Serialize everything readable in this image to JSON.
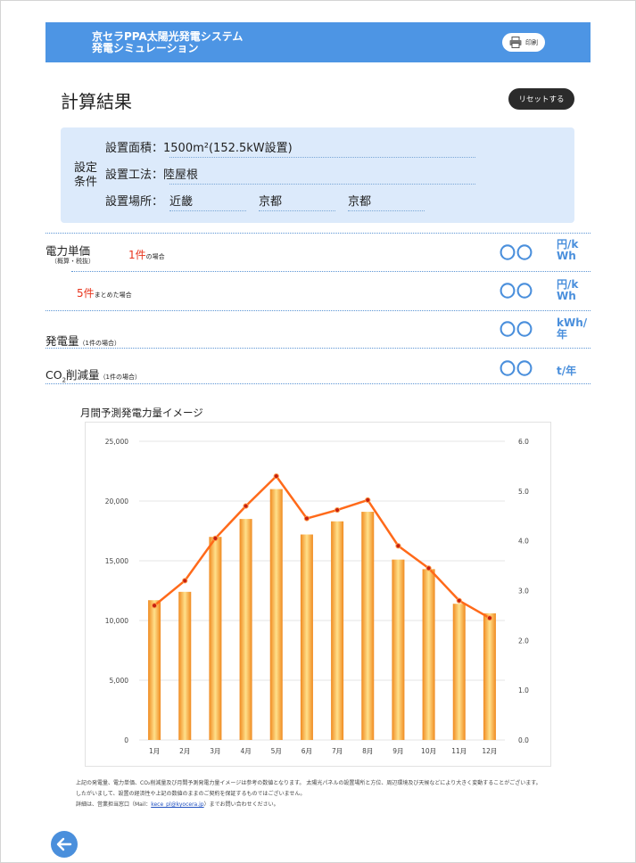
{
  "header": {
    "title_line1": "京セラPPA太陽光発電システム",
    "title_line2": "発電シミュレーション",
    "print_label": "印刷"
  },
  "page_title": "計算結果",
  "reset_label": "リセットする",
  "conditions": {
    "title": "設定条件",
    "area_label": "設置面積：",
    "area_value": "1500m²(152.5kW設置)",
    "method_label": "設置工法：",
    "method_value": "陸屋根",
    "place_label": "設置場所：",
    "region": "近畿",
    "prefecture": "京都",
    "city": "京都"
  },
  "results": {
    "unit_price_label": "電力単価",
    "unit_price_note": "（概算・税抜）",
    "case1_count": "1件",
    "case1_suffix": "の場合",
    "case1_value": "〇〇",
    "case1_unit_l1": "円/k",
    "case1_unit_l2": "Wh",
    "case5_count": "5件",
    "case5_suffix": "まとめた場合",
    "case5_value": "〇〇",
    "case5_unit_l1": "円/k",
    "case5_unit_l2": "Wh",
    "gen_label": "発電量",
    "gen_note": "（1件の場合）",
    "gen_value": "〇〇",
    "gen_unit_l1": "kWh/",
    "gen_unit_l2": "年",
    "co2_label_a": "CO",
    "co2_label_sub": "2",
    "co2_label_b": "削減量",
    "co2_note": "（1件の場合）",
    "co2_value": "〇〇",
    "co2_unit": "t/年"
  },
  "chart_title": "月間予測発電力量イメージ",
  "chart_data": {
    "type": "bar",
    "title": "月間予測発電力量イメージ",
    "categories": [
      "1月",
      "2月",
      "3月",
      "4月",
      "5月",
      "6月",
      "7月",
      "8月",
      "9月",
      "10月",
      "11月",
      "12月"
    ],
    "series": [
      {
        "values": [
          11700,
          12400,
          17000,
          18500,
          21000,
          17200,
          18300,
          19100,
          15100,
          14300,
          11400,
          10600
        ]
      },
      {
        "type": "line",
        "axis": "right",
        "values": [
          2.7,
          3.2,
          4.05,
          4.7,
          5.3,
          4.45,
          4.62,
          4.82,
          3.9,
          3.45,
          2.8,
          2.45
        ]
      }
    ],
    "ylim": [
      0,
      25000
    ],
    "y_ticks": [
      "0",
      "5,000",
      "10,000",
      "15,000",
      "20,000",
      "25,000"
    ],
    "y2lim": [
      0,
      6
    ],
    "y2_ticks": [
      "0.0",
      "1.0",
      "2.0",
      "3.0",
      "4.0",
      "5.0",
      "6.0"
    ],
    "grid": true,
    "colors": {
      "bar": "#f5a640",
      "line": "#ff6a1a",
      "marker": "#c62010"
    }
  },
  "footnote": {
    "line1": "上記の発電量、電力単価、CO₂削減量及び月間予測発電力量イメージは参考の数値となります。 太陽光パネルの設置場所と方位、周辺環境及び天候などにより大きく変動することがございます。",
    "line2": "したがいまして、設置の経済性や上記の数値のままのご契約を保証するものではございません。",
    "line3_a": "詳細は、営業担当窓口（Mail：",
    "line3_mail": "kece_pl@kyocera.jp",
    "line3_b": "）までお問い合わせください。"
  }
}
